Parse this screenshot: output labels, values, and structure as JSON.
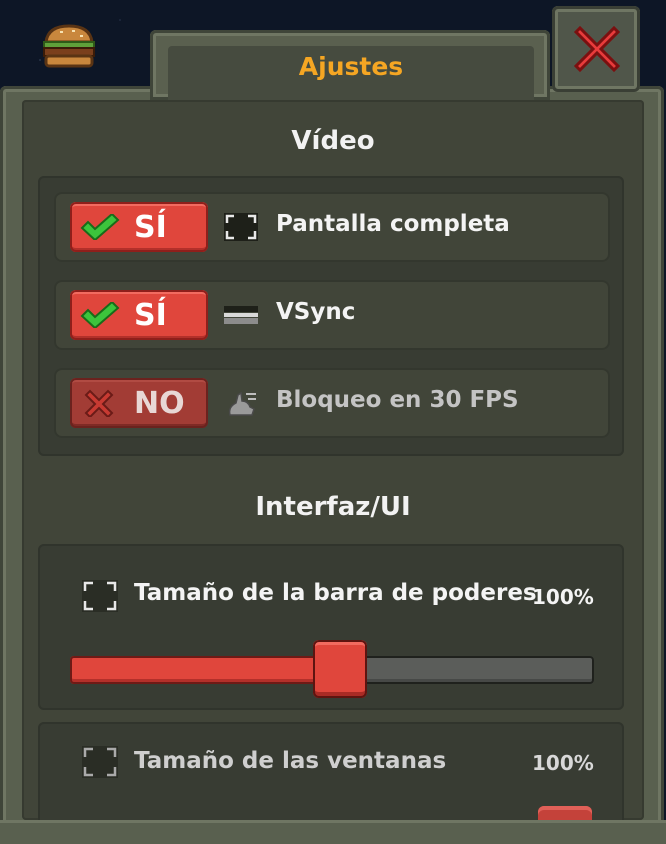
{
  "window": {
    "title": "Ajustes",
    "close_icon": "close-x-icon",
    "logo_icon": "burger-icon"
  },
  "video": {
    "heading": "Vídeo",
    "options": [
      {
        "toggle": "SÍ",
        "state": "on",
        "icon": "fullscreen-icon",
        "label": "Pantalla completa"
      },
      {
        "toggle": "SÍ",
        "state": "on",
        "icon": "vsync-icon",
        "label": "VSync"
      },
      {
        "toggle": "NO",
        "state": "off",
        "icon": "rabbit-icon",
        "label": "Bloqueo en 30 FPS"
      }
    ]
  },
  "interface": {
    "heading": "Interfaz/UI",
    "sliders": [
      {
        "label": "Tamaño de la barra de poderes",
        "value": "100%",
        "fraction": 0.5
      },
      {
        "label": "Tamaño de las ventanas",
        "value": "100%"
      }
    ]
  },
  "colors": {
    "accent": "#f5a623",
    "toggle_on": "#e0463c",
    "toggle_off": "#a23c35",
    "check": "#3cc43c"
  }
}
